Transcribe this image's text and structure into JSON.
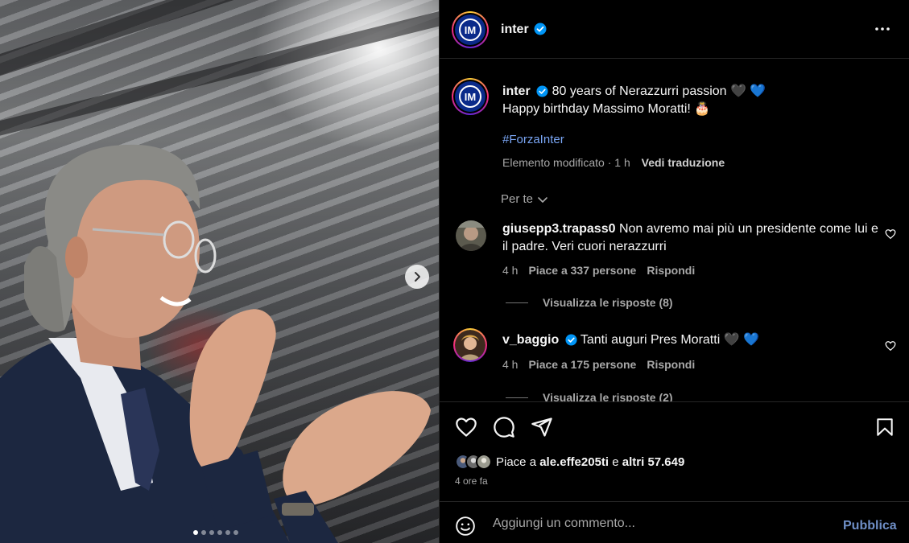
{
  "post": {
    "photo_alt": "Massimo Moratti applaudendo allo stadio",
    "carousel": {
      "count": 6,
      "active_index": 0
    }
  },
  "header": {
    "username": "inter",
    "verified": true
  },
  "caption": {
    "username": "inter",
    "line1": "80 years of Nerazzurri passion 🖤 💙",
    "line2": "Happy birthday Massimo Moratti! 🎂",
    "hashtag": "#ForzaInter",
    "edited_label": "Elemento modificato · 1 h",
    "translate_label": "Vedi traduzione"
  },
  "filter": {
    "label": "Per te"
  },
  "comments": [
    {
      "username": "giusepp3.trapass0",
      "verified": false,
      "text": "Non avremo mai più un presidente come lui e il padre. Veri cuori nerazzurri",
      "time": "4 h",
      "likes": "Piace a 337 persone",
      "reply_label": "Rispondi",
      "view_replies": "Visualizza le risposte (8)"
    },
    {
      "username": "v_baggio",
      "verified": true,
      "text": "Tanti auguri Pres Moratti 🖤 💙",
      "time": "4 h",
      "likes": "Piace a 175 persone",
      "reply_label": "Rispondi",
      "view_replies": "Visualizza le risposte (2)"
    }
  ],
  "likes": {
    "prefix": "Piace a ",
    "user": "ale.effe205ti",
    "middle": " e ",
    "others": "altri 57.649"
  },
  "time_ago": "4 ore fa",
  "add_comment": {
    "placeholder": "Aggiungi un commento...",
    "publish_label": "Pubblica"
  },
  "colors": {
    "background": "#000000",
    "link_blue": "#7aa6f5",
    "verified_blue": "#0095f6",
    "inter_blue": "#0a2a8a",
    "muted_text": "#a8a8a8"
  }
}
